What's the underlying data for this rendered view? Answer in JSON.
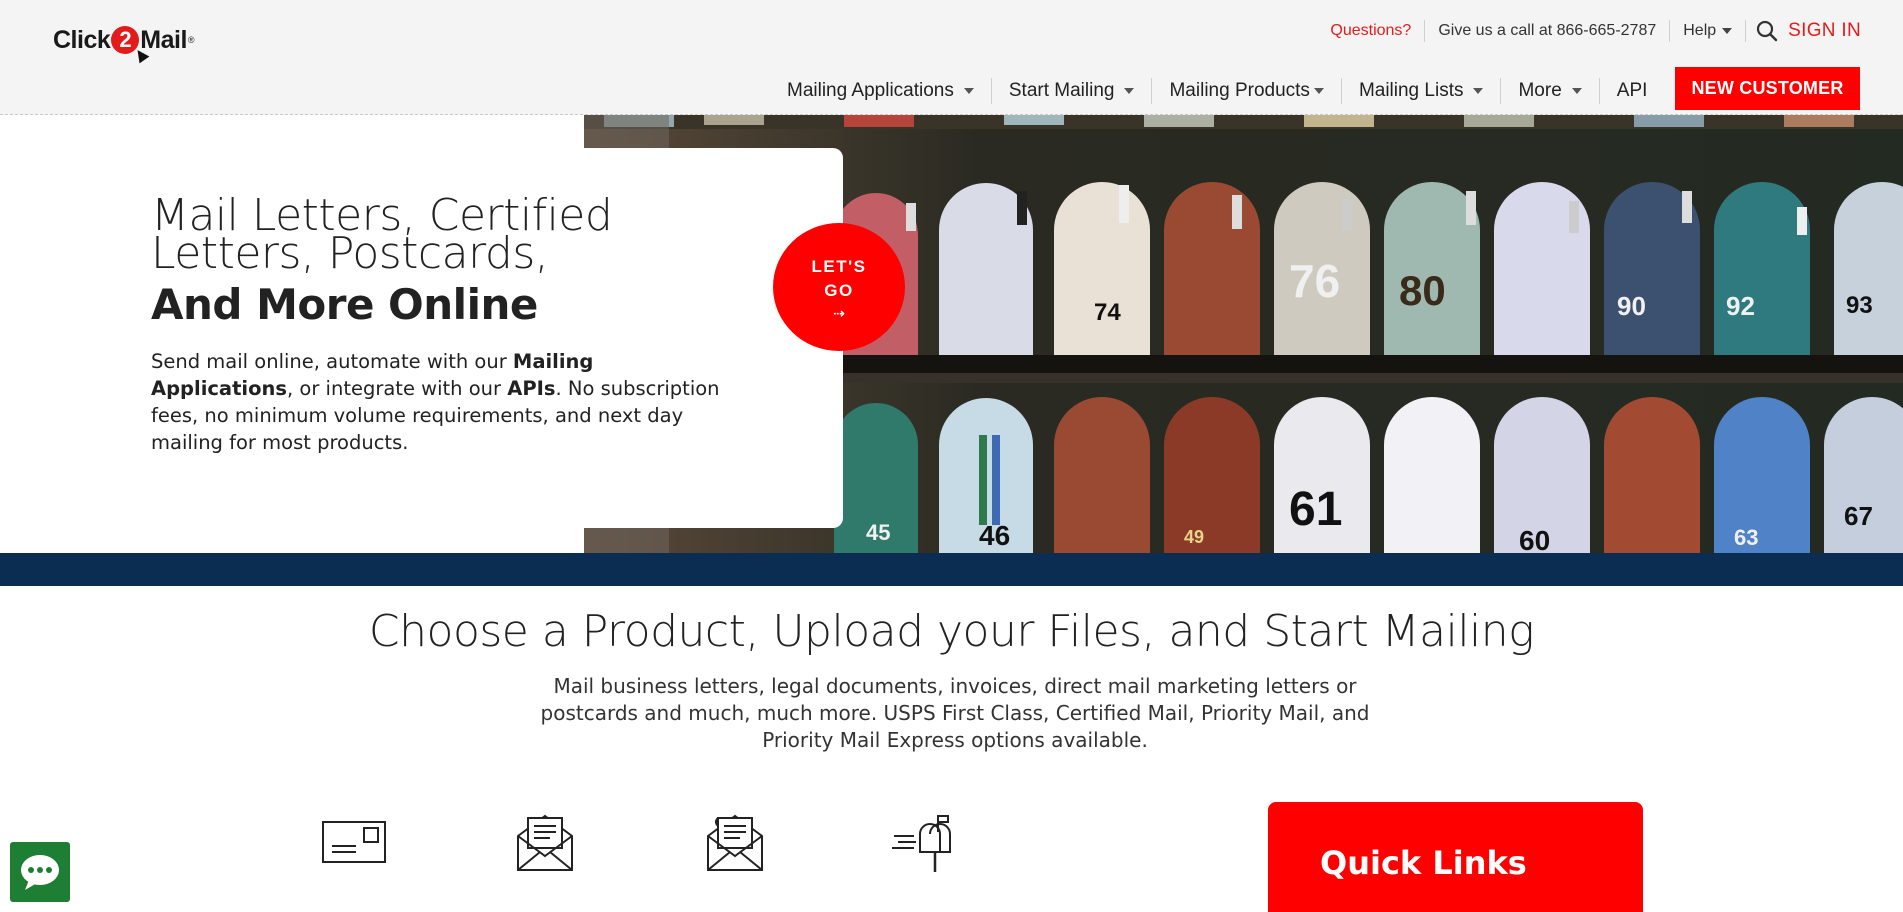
{
  "brand": {
    "logo_pre": "Click",
    "logo_two": "2",
    "logo_post": "Mail",
    "logo_tm": "®"
  },
  "utility": {
    "questions": "Questions?",
    "call": "Give us a call at 866-665-2787",
    "help": "Help",
    "signin": "SIGN IN"
  },
  "nav": {
    "items": [
      {
        "label": "Mailing Applications"
      },
      {
        "label": "Start Mailing"
      },
      {
        "label": "Mailing Products"
      },
      {
        "label": "Mailing Lists"
      },
      {
        "label": "More"
      },
      {
        "label": "API"
      }
    ],
    "cta": "NEW CUSTOMER"
  },
  "hero": {
    "title_line1": "Mail Letters, Certified Letters, Postcards,",
    "title_line2": "And More Online",
    "desc_1": "Send mail online, automate with our ",
    "desc_link1": "Mailing Applications",
    "desc_2": ", or integrate with our ",
    "desc_link2": "APIs",
    "desc_3": ". No subscription fees, no minimum volume requirements, and next day mailing for most products.",
    "cta_line1": "LET'S",
    "cta_line2": "GO",
    "cta_arrow": "⇢",
    "mailbox_numbers": [
      "74",
      "76",
      "80",
      "90",
      "92",
      "93",
      "45",
      "46",
      "49",
      "61",
      "60",
      "63",
      "67"
    ]
  },
  "section": {
    "title": "Choose a Product, Upload your Files, and Start Mailing",
    "desc": "Mail business letters, legal documents, invoices, direct mail marketing letters or postcards and much, much more. USPS First Class, Certified Mail, Priority Mail, and Priority Mail Express options available.",
    "products": [
      {
        "icon": "postcard-icon"
      },
      {
        "icon": "letter-envelope-icon"
      },
      {
        "icon": "certified-letter-icon"
      },
      {
        "icon": "mailbox-icon"
      }
    ]
  },
  "quick_links": {
    "title": "Quick Links"
  },
  "colors": {
    "brand_red": "#ff0000",
    "navy": "#0b2d52",
    "chat_green": "#1e7e34"
  }
}
